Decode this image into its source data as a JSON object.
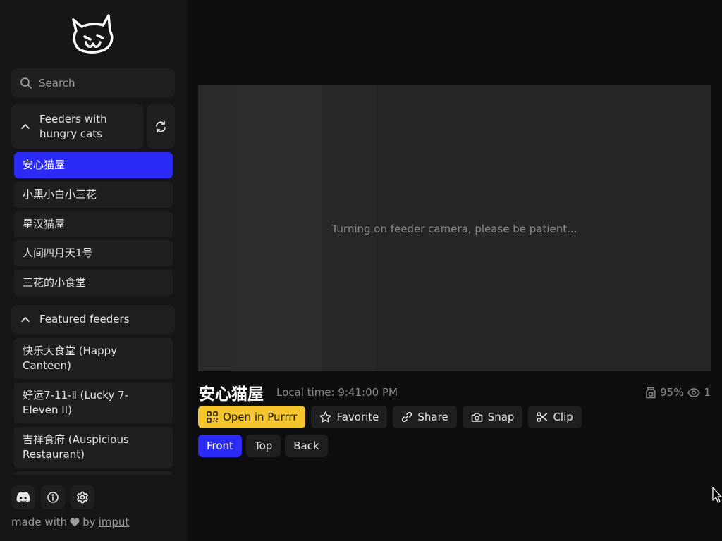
{
  "sidebar": {
    "search_placeholder": "Search",
    "section1": {
      "title": "Feeders with hungry cats",
      "title_line1": "Feeders with",
      "title_line2": "hungry cats"
    },
    "feeders": [
      {
        "name": "安心猫屋"
      },
      {
        "name": "小黑小白小三花"
      },
      {
        "name": "星汉猫屋"
      },
      {
        "name": "人间四月天1号"
      },
      {
        "name": "三花的小食堂"
      }
    ],
    "section2": {
      "title": "Featured feeders"
    },
    "featured": [
      {
        "line1": "快乐大食堂 (Happy",
        "line2": "Canteen)"
      },
      {
        "line1": "好运7-11-Ⅱ (Lucky 7-",
        "line2": "Eleven II)"
      },
      {
        "line1": "吉祥食府 (Auspicious",
        "line2": "Restaurant)"
      }
    ],
    "footer": {
      "made_with": "made with",
      "by": "by",
      "author": "imput"
    }
  },
  "viewer": {
    "status": "Turning on feeder camera, please be patient..."
  },
  "feeder": {
    "title": "安心猫屋",
    "local_time": "Local time: 9:41:00 PM",
    "battery": "95%",
    "viewers": "1"
  },
  "actions": {
    "open": "Open in Purrrr",
    "favorite": "Favorite",
    "share": "Share",
    "snap": "Snap",
    "clip": "Clip"
  },
  "views": {
    "front": "Front",
    "top": "Top",
    "back": "Back",
    "selected": "Front"
  },
  "colors": {
    "accent": "#2b2bf5",
    "primary": "#f5c52e",
    "background": "#0e0e10",
    "sidebar": "#161618"
  }
}
